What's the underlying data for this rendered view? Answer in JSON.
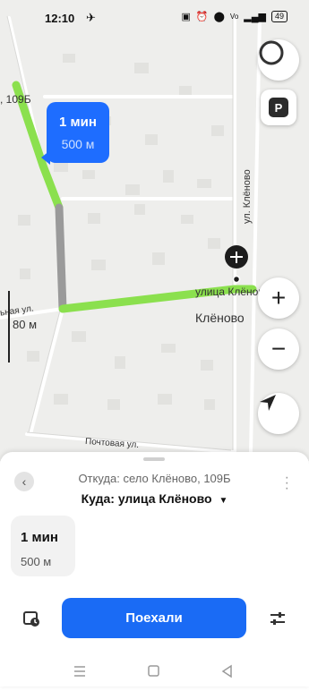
{
  "status_bar": {
    "time": "12:10",
    "icons": [
      "nfc-icon",
      "alarm-icon",
      "location-icon",
      "volte-icon",
      "signal-icon"
    ],
    "battery": "49"
  },
  "map": {
    "route_bubble": {
      "time": "1 мин",
      "distance": "500 м"
    },
    "labels": {
      "address_top": ", 109Б",
      "street_vertical": "ул. Клёново",
      "destination_street": "улица Клёново",
      "village": "Клёново",
      "street_left": "ьная ул.",
      "street_bottom": "Почтовая ул."
    },
    "scale": "80 м",
    "buttons": {
      "parking": "P",
      "zoom_in": "+",
      "zoom_out": "−"
    },
    "colors": {
      "route": "#8be04e",
      "route_gray": "#9a9a9a",
      "road": "#ffffff"
    }
  },
  "sheet": {
    "from": "Откуда: село Клёново, 109Б",
    "to": "Куда: улица Клёново",
    "to_arrow": "▼",
    "route_card": {
      "time": "1 мин",
      "distance": "500 м"
    },
    "go_button": "Поехали"
  },
  "colors": {
    "accent": "#1a6bf5"
  }
}
